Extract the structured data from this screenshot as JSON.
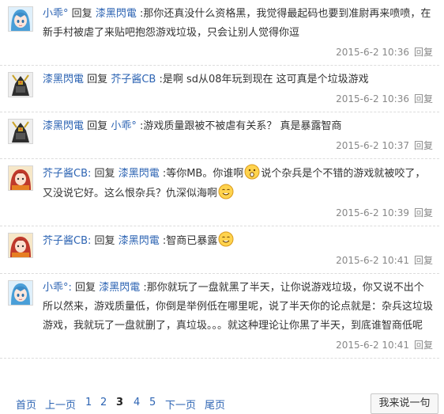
{
  "posts": [
    {
      "avatar": "anime-girl-avatar",
      "user": "小乖°",
      "reply_word": "回复",
      "target": "漆黑閃電",
      "segments": [
        " :那你还真没什么资格黑，我觉得最起码也要到准尉再来喷喷，在新手村被虐了来贴吧抱怨游戏垃圾，只会让别人觉得你逗"
      ],
      "time": "2015-6-2 10:36",
      "action": "回复"
    },
    {
      "avatar": "robot-avatar",
      "user": "漆黑閃電",
      "reply_word": "回复",
      "target": "芥子酱CB",
      "segments": [
        " :是啊 sd从08年玩到现在 这可真是个垃圾游戏"
      ],
      "time": "2015-6-2 10:36",
      "action": "回复"
    },
    {
      "avatar": "robot-avatar",
      "user": "漆黑閃電",
      "reply_word": "回复",
      "target": "小乖°",
      "segments": [
        " :游戏质量跟被不被虐有关系？ 真是暴露智商"
      ],
      "time": "2015-6-2 10:37",
      "action": "回复"
    },
    {
      "avatar": "anime-girl2-avatar",
      "user": "芥子酱CB:",
      "reply_word": "回复",
      "target": "漆黑閃電",
      "segments": [
        " :等你MB。你谁啊",
        "说个杂兵是个不错的游戏就被咬了，又没说它好。这么恨杂兵？仇深似海啊"
      ],
      "emojis": [
        "surprised-emoji",
        "smile-emoji"
      ],
      "time": "2015-6-2 10:39",
      "action": "回复"
    },
    {
      "avatar": "anime-girl2-avatar",
      "user": "芥子酱CB:",
      "reply_word": "回复",
      "target": "漆黑閃電",
      "segments": [
        " :智商已暴露"
      ],
      "emojis": [
        "smile-emoji"
      ],
      "time": "2015-6-2 10:41",
      "action": "回复"
    },
    {
      "avatar": "anime-girl-avatar",
      "user": "小乖°:",
      "reply_word": "回复",
      "target": "漆黑閃電",
      "segments": [
        " :那你就玩了一盘就黑了半天，让你说游戏垃圾，你又说不出个所以然来，游戏质量低，你倒是举例低在哪里呢，说了半天你的论点就是：杂兵这垃圾游戏，我就玩了一盘就删了，真垃圾。。。就这种理论让你黑了半天，到底谁智商低呢"
      ],
      "time": "2015-6-2 10:41",
      "action": "回复"
    }
  ],
  "pager": {
    "first": "首页",
    "prev": "上一页",
    "pages": [
      "1",
      "2",
      "3",
      "4",
      "5"
    ],
    "current": "3",
    "next": "下一页",
    "last": "尾页",
    "say_button": "我来说一句"
  },
  "colors": {
    "link": "#2d64b3",
    "meta": "#888888",
    "divider": "#dcdcdc"
  }
}
